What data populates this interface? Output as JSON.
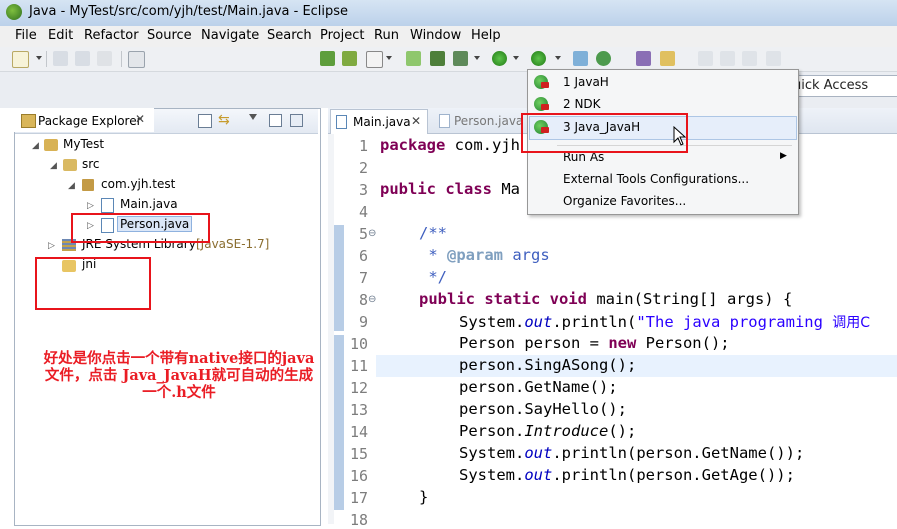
{
  "window": {
    "title": "Java - MyTest/src/com/yjh/test/Main.java - Eclipse"
  },
  "menubar": {
    "items": [
      "File",
      "Edit",
      "Refactor",
      "Source",
      "Navigate",
      "Search",
      "Project",
      "Run",
      "Window",
      "Help"
    ]
  },
  "quick_access": {
    "label": "uick Access"
  },
  "package_explorer": {
    "title": "Package Explorer",
    "tree": {
      "project": "MyTest",
      "src": "src",
      "package": "com.yjh.test",
      "file1": "Main.java",
      "file2": "Person.java",
      "jre": "JRE System Library",
      "jre_version": "[JavaSE-1.7]",
      "folder": "jni"
    }
  },
  "editor": {
    "tabs": [
      "Main.java",
      "Person.java"
    ],
    "line_numbers": [
      "1",
      "2",
      "3",
      "4",
      "5",
      "6",
      "7",
      "8",
      "9",
      "10",
      "11",
      "12",
      "13",
      "14",
      "15",
      "16",
      "17",
      "18"
    ],
    "code": {
      "l1_kw": "package",
      "l1_rest": " com.yjh",
      "l3_kw": "public class",
      "l3_rest": " Ma",
      "l5": "/**",
      "l6_a": " * ",
      "l6_tag": "@param",
      "l6_b": " args",
      "l7": " */",
      "l8_kw": "public static void",
      "l8_rest": " main(String[] args) {",
      "l9_a": "System.",
      "l9_out": "out",
      "l9_b": ".println(",
      "l9_str": "\"The java programing ",
      "l9_c": "调用C",
      "l10_a": "Person person = ",
      "l10_kw": "new",
      "l10_b": " Person();",
      "l11": "person.SingASong();",
      "l12": "person.GetName();",
      "l13": "person.SayHello();",
      "l14_a": "Person.",
      "l14_it": "Introduce",
      "l14_b": "();",
      "l15_a": "System.",
      "l15_out": "out",
      "l15_b": ".println(person.GetName());",
      "l16_a": "System.",
      "l16_out": "out",
      "l16_b": ".println(person.GetAge());",
      "l17": "}"
    }
  },
  "dropdown": {
    "items": [
      "1 JavaH",
      "2 NDK",
      "3 Java_JavaH"
    ],
    "run_as": "Run As",
    "external_tools": "External Tools Configurations...",
    "organize": "Organize Favorites..."
  },
  "annotation": {
    "line1": "好处是你点击一个带有native接口的java",
    "line2": "文件，点击 Java_JavaH就可自动的生成",
    "line3": "一个.h文件"
  },
  "colors": {
    "annotation_red": "#e8141b",
    "keyword": "#7f0055",
    "string": "#2a00ff",
    "javadoc": "#3f5fbf"
  }
}
